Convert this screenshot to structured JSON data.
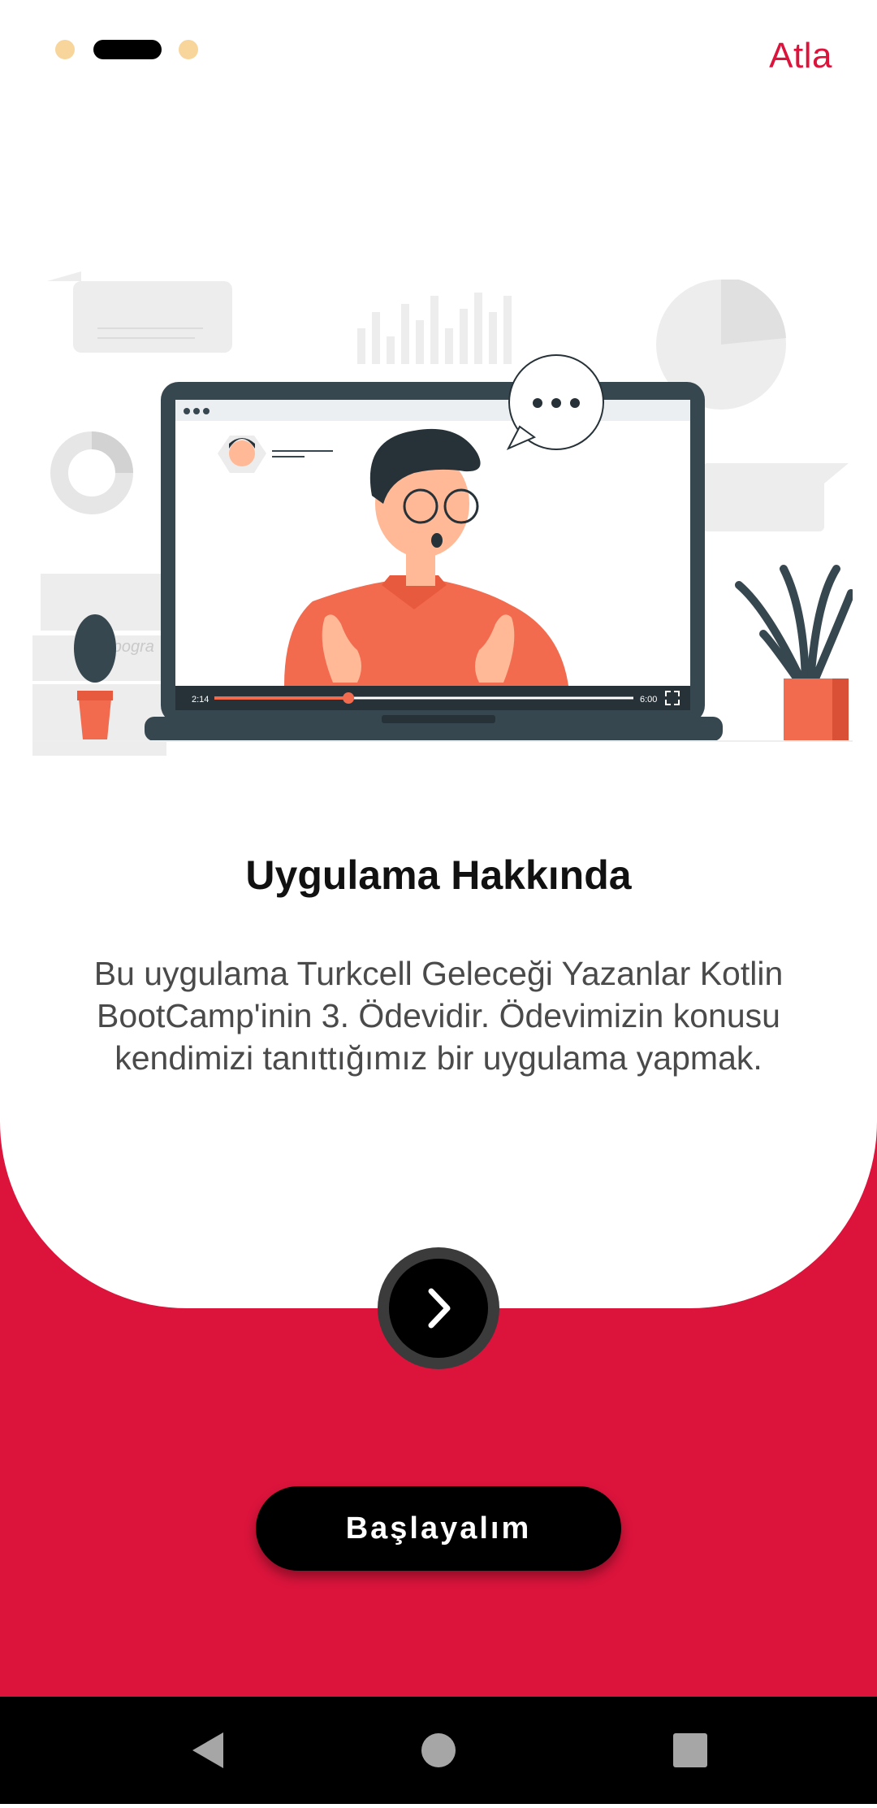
{
  "onboarding": {
    "page_indicator": {
      "total": 3,
      "active_index": 1
    },
    "skip_label": "Atla",
    "title": "Uygulama Hakkında",
    "description": "Bu uygulama Turkcell Geleceği Yazanlar Kotlin BootCamp'inin 3. Ödevidir. Ödevimizin konusu kendimizi tanıttığımız bir uygulama yapmak.",
    "start_label": "Başlayalım",
    "next_icon": "chevron-right-icon"
  },
  "illustration": {
    "icon": "video-call-illustration",
    "video_elapsed": "2:14",
    "video_total": "6:00",
    "video_progress": 0.32,
    "background_label": "Typogra"
  },
  "system_nav": {
    "back_icon": "back-triangle-icon",
    "home_icon": "home-circle-icon",
    "recents_icon": "recents-square-icon"
  },
  "colors": {
    "accent": "#dc143c",
    "dot_inactive": "#f7d59b",
    "dot_active": "#000000",
    "button": "#000000",
    "shirt": "#f26b4f",
    "laptop": "#37474f",
    "nav_icons": "#a6a6a6"
  }
}
